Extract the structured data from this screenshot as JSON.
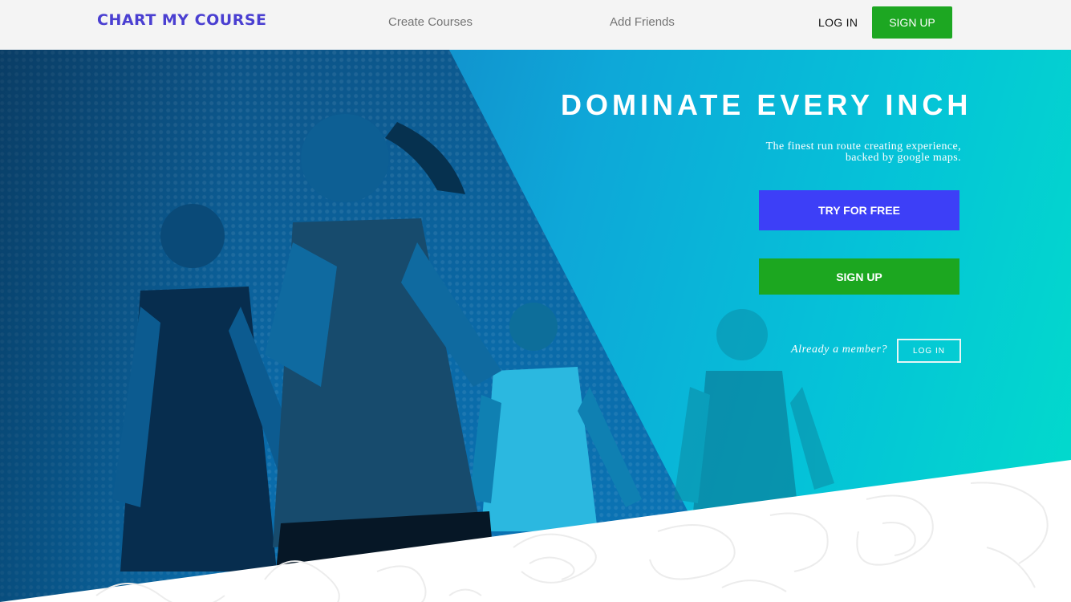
{
  "nav": {
    "logo": "CHART MY COURSE",
    "links": [
      "Create Courses",
      "Add Friends"
    ],
    "login_label": "LOG IN",
    "signup_label": "SIGN UP"
  },
  "hero": {
    "title": "DOMINATE EVERY INCH",
    "subtitle": "The finest run route creating experience, backed by google maps.",
    "try_label": "TRY FOR FREE",
    "signup_label": "SIGN UP",
    "member_prompt": "Already a member?",
    "login_label": "LOG IN"
  },
  "colors": {
    "logo": "#4a3fd1",
    "signup_green": "#1da722",
    "try_blue": "#3d3ff7",
    "hero_gradient_start": "#0b5f9a",
    "hero_gradient_end": "#02dccb"
  }
}
